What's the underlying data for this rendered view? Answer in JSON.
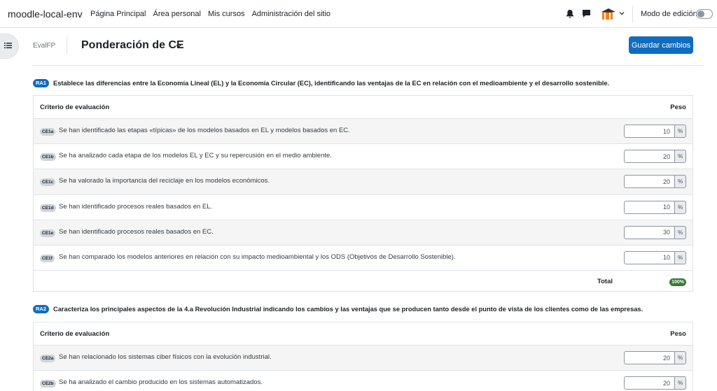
{
  "navbar": {
    "site_name": "moodle-local-env",
    "links": [
      "Página Principal",
      "Área personal",
      "Mis cursos",
      "Administración del sitio"
    ],
    "edit_mode_label": "Modo de edición"
  },
  "header": {
    "context": "EvalFP",
    "title": "Ponderación de CE",
    "save_label": "Guardar cambios"
  },
  "table_headers": {
    "criterion": "Criterio de evaluación",
    "weight": "Peso"
  },
  "unit_symbol": "%",
  "sections": [
    {
      "badge": "RA1",
      "title": "Establece las diferencias entre la Economía Lineal (EL) y la Economía Circular (EC), identificando las ventajas de la EC en relación con el medioambiente y el desarrollo sostenible.",
      "rows": [
        {
          "code": "CE1a",
          "text": "Se han identificado las etapas «típicas» de los modelos basados en EL y modelos basados en EC.",
          "weight": "10"
        },
        {
          "code": "CE1b",
          "text": "Se ha analizado cada etapa de los modelos EL y EC y su repercusión en el medio ambiente.",
          "weight": "20"
        },
        {
          "code": "CE1c",
          "text": "Se ha valorado la importancia del reciclaje en los modelos económicos.",
          "weight": "20"
        },
        {
          "code": "CE1d",
          "text": "Se han identificado procesos reales basados en EL.",
          "weight": "10"
        },
        {
          "code": "CE1e",
          "text": "Se han identificado procesos reales basados en EC.",
          "weight": "30"
        },
        {
          "code": "CE1f",
          "text": "Se han comparado los modelos anteriores en relación con su impacto medioambiental y los ODS (Objetivos de Desarrollo Sostenible).",
          "weight": "10"
        }
      ],
      "total_label": "Total",
      "total_value": "100%"
    },
    {
      "badge": "RA2",
      "title": "Caracteriza los principales aspectos de la 4.a Revolución Industrial indicando los cambios y las ventajas que se producen tanto desde el punto de vista de los clientes como de las empresas.",
      "rows": [
        {
          "code": "CE2a",
          "text": "Se han relacionado los sistemas ciber físicos con la evolución industrial.",
          "weight": "20"
        },
        {
          "code": "CE2b",
          "text": "Se ha analizado el cambio producido en los sistemas automatizados.",
          "weight": "20"
        }
      ]
    }
  ]
}
